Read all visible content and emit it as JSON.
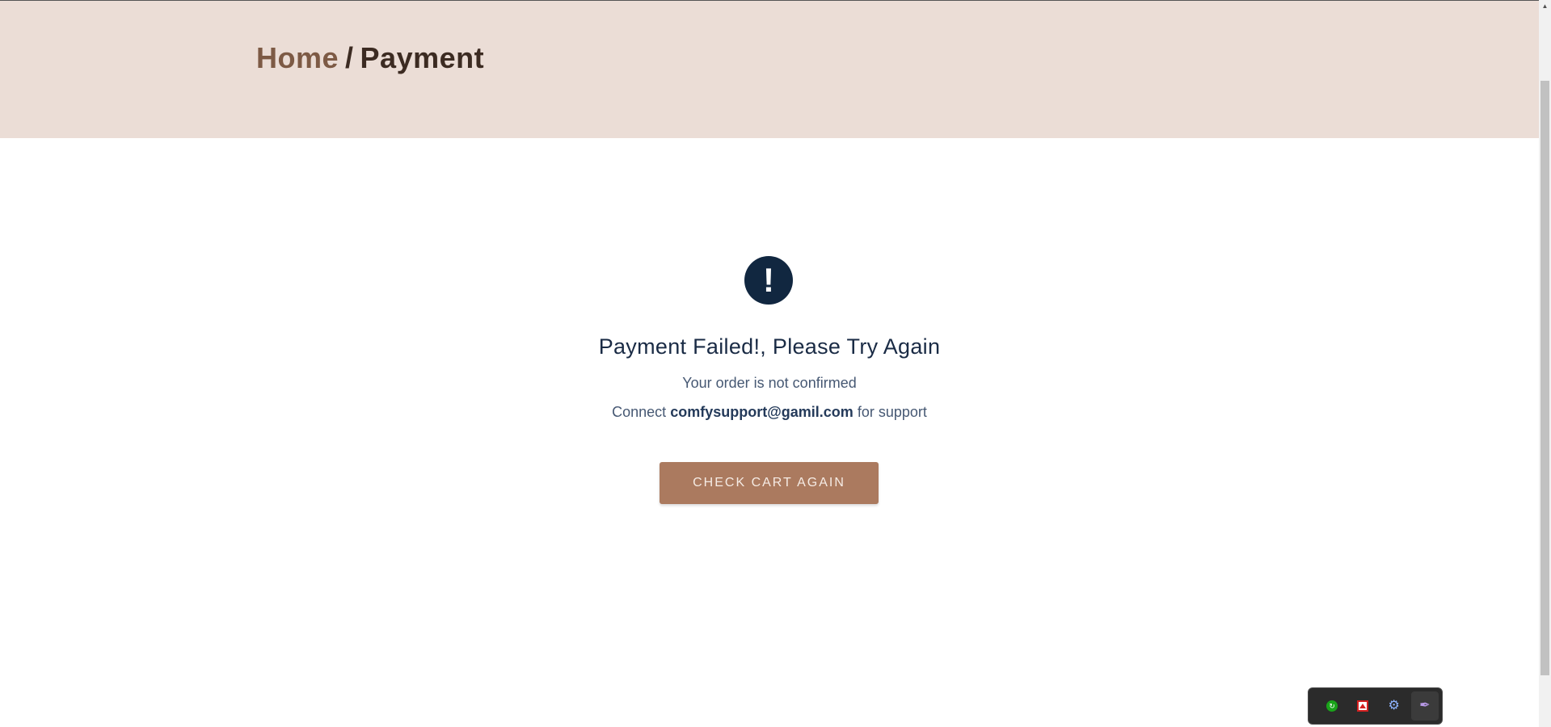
{
  "breadcrumb": {
    "home": "Home",
    "separator": "/",
    "current": "Payment"
  },
  "status": {
    "icon": "exclamation-icon",
    "icon_glyph": "!",
    "title": "Payment Failed!, Please Try Again",
    "message": "Your order is not confirmed",
    "support_prefix": "Connect",
    "support_email": "comfysupport@gamil.com",
    "support_suffix": "for support"
  },
  "cta": {
    "label": "CHECK CART AGAIN"
  },
  "tray": {
    "items": [
      {
        "icon": "green-extension-icon"
      },
      {
        "icon": "pdf-extension-icon"
      },
      {
        "icon": "gear-extension-icon"
      },
      {
        "icon": "feather-extension-icon"
      }
    ]
  },
  "colors": {
    "hero_bg": "#ebddd6",
    "home_link": "#7d5a45",
    "breadcrumb_text": "#3c2b22",
    "alert_circle": "#112740",
    "title_text": "#1a2b45",
    "body_text": "#465873",
    "button_bg": "#ab7a5f"
  }
}
